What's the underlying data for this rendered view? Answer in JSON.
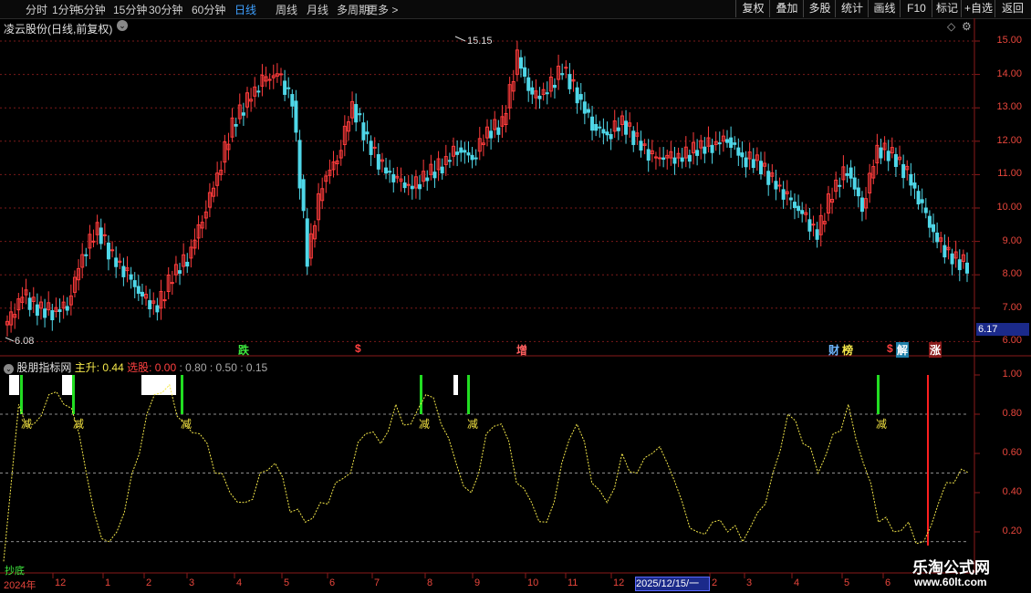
{
  "toolbar": {
    "periods": [
      "分时",
      "1分钟",
      "5分钟",
      "15分钟",
      "30分钟",
      "60分钟",
      "日线",
      "周线",
      "月线",
      "多周期",
      "更多 >"
    ],
    "active_period": "日线",
    "right_buttons": [
      "复权",
      "叠加",
      "多股",
      "统计",
      "画线",
      "F10",
      "标记",
      "+自选",
      "返回"
    ]
  },
  "main_chart": {
    "title": "凌云股份(日线,前复权)",
    "price_labels": [
      "15.00",
      "14.00",
      "13.00",
      "12.00",
      "11.00",
      "10.00",
      "9.00",
      "8.00",
      "7.00",
      "6.00"
    ],
    "high_mark": "15.15",
    "low_mark": "6.08",
    "current_price": "6.17",
    "events": [
      "跌",
      "$",
      "增",
      "财",
      "榜",
      "$",
      "解",
      "涨"
    ]
  },
  "indicator": {
    "name": "股朋指标网",
    "main_label": "主升:",
    "main_value": "0.44",
    "pick_label": "选股:",
    "pick_value": "0.00",
    "levels": ": 0.80 : 0.50 : 0.15",
    "axis_labels": [
      "1.00",
      "0.80",
      "0.60",
      "0.40",
      "0.20"
    ],
    "bottom_tag": "抄底",
    "signal_label": "减"
  },
  "date_axis": {
    "labels": [
      "2024年",
      "12",
      "1",
      "2",
      "3",
      "4",
      "5",
      "6",
      "7",
      "8",
      "9",
      "10",
      "11",
      "12",
      "2",
      "3",
      "4",
      "5",
      "6"
    ],
    "cursor_date": "2025/12/15/一"
  },
  "watermark": {
    "line1": "乐淘公式网",
    "line2": "www.60lt.com"
  },
  "colors": {
    "up": "#ff3c3c",
    "down": "#4fd7e8",
    "line": "#f5e84a",
    "green_bar": "#22dd22",
    "red_bar": "#ff2020",
    "grid": "#7a1a1a"
  },
  "chart_data": {
    "type": "line",
    "title": "凌云股份(日线,前复权)",
    "x_labels": [
      "2024年",
      "12",
      "1",
      "2",
      "3",
      "4",
      "5",
      "6",
      "7",
      "8",
      "9",
      "10",
      "11",
      "12",
      "2",
      "3",
      "4",
      "5",
      "6"
    ],
    "price_range": [
      5.8,
      15.4
    ],
    "price_closes": [
      6.5,
      7.4,
      7.0,
      6.9,
      7.1,
      8.6,
      9.4,
      8.5,
      8.0,
      7.3,
      7.0,
      8.0,
      8.5,
      9.7,
      11.0,
      12.5,
      13.2,
      13.8,
      14.0,
      13.2,
      8.5,
      10.8,
      11.5,
      13.1,
      12.0,
      11.2,
      10.8,
      10.6,
      11.0,
      11.3,
      11.8,
      11.5,
      12.3,
      12.5,
      14.5,
      13.3,
      13.5,
      14.2,
      13.4,
      12.5,
      12.2,
      12.6,
      12.0,
      11.5,
      11.5,
      11.5,
      11.8,
      11.9,
      12.1,
      11.5,
      11.4,
      10.8,
      10.3,
      9.8,
      9.2,
      10.5,
      11.2,
      10.0,
      11.8,
      11.6,
      11.0,
      10.0,
      9.0,
      8.5,
      8.3
    ],
    "indicator_range": [
      0.1,
      1.05
    ],
    "indicator_series": [
      0.05,
      0.85,
      0.75,
      0.9,
      0.85,
      0.7,
      0.3,
      0.15,
      0.3,
      0.6,
      0.9,
      0.95,
      0.75,
      0.7,
      0.5,
      0.4,
      0.35,
      0.5,
      0.55,
      0.3,
      0.25,
      0.35,
      0.45,
      0.5,
      0.7,
      0.65,
      0.85,
      0.75,
      0.9,
      0.75,
      0.55,
      0.4,
      0.7,
      0.75,
      0.45,
      0.35,
      0.25,
      0.55,
      0.75,
      0.45,
      0.35,
      0.6,
      0.5,
      0.6,
      0.55,
      0.35,
      0.2,
      0.25,
      0.2,
      0.15,
      0.3,
      0.5,
      0.8,
      0.65,
      0.5,
      0.7,
      0.85,
      0.55,
      0.25,
      0.2,
      0.25,
      0.15,
      0.35,
      0.45,
      0.5
    ],
    "levels": [
      0.8,
      0.5,
      0.15
    ]
  }
}
